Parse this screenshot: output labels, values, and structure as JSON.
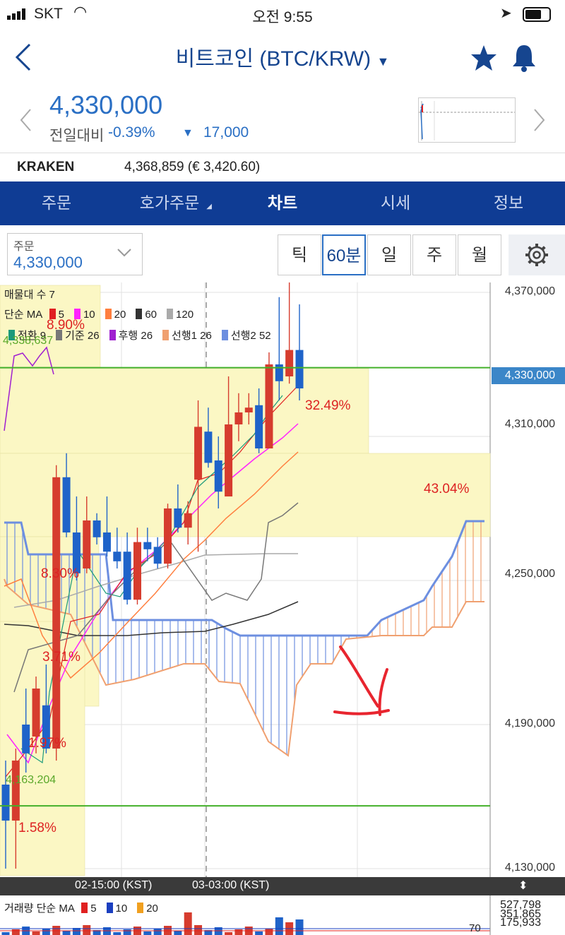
{
  "status_bar": {
    "carrier": "SKT",
    "time": "오전 9:55"
  },
  "nav": {
    "title": "비트코인 (BTC/KRW)"
  },
  "quote": {
    "price": "4,330,000",
    "change_label": "전일대비",
    "change_pct": "-0.39%",
    "change_amount": "17,000"
  },
  "exchange": {
    "name": "KRAKEN",
    "value": "4,368,859 (€ 3,420.60)"
  },
  "tabs": [
    "주문",
    "호가주문",
    "차트",
    "시세",
    "정보"
  ],
  "order_box": {
    "label": "주문",
    "value": "4,330,000"
  },
  "periods": [
    "틱",
    "60분",
    "일",
    "주",
    "월"
  ],
  "chart": {
    "volume_profile_label": "매물대 수 7",
    "ma_label": "단순 MA",
    "ma_items": [
      {
        "label": "5",
        "color": "#e02020"
      },
      {
        "label": "10",
        "color": "#ff22ff"
      },
      {
        "label": "20",
        "color": "#ff7f3f"
      },
      {
        "label": "60",
        "color": "#333333"
      },
      {
        "label": "120",
        "color": "#aaaaaa"
      }
    ],
    "ichimoku_items": [
      {
        "label": "전환 9",
        "color": "#1a9a7a"
      },
      {
        "label": "기준 26",
        "color": "#777777"
      },
      {
        "label": "후행 26",
        "color": "#a020d0"
      },
      {
        "label": "선행1 26",
        "color": "#f0a070"
      },
      {
        "label": "선행2 52",
        "color": "#6d8fe0"
      }
    ],
    "y_ticks": [
      "4,370,000",
      "4,310,000",
      "4,250,000",
      "4,190,000",
      "4,130,000"
    ],
    "current_price_tag": "4,330,000",
    "high_mark": "4,338,637",
    "low_mark": "4,163,204",
    "profile_pcts": [
      "8.90%",
      "32.49%",
      "43.04%",
      "8.30%",
      "3.71%",
      "1.97%",
      "1.58%"
    ],
    "x_ticks": [
      "02-15:00 (KST)",
      "03-03:00 (KST)"
    ],
    "volume_label": "거래량 단순 MA",
    "volume_ma_items": [
      {
        "label": "5",
        "color": "#e02020"
      },
      {
        "label": "10",
        "color": "#1b3fc0"
      },
      {
        "label": "20",
        "color": "#f0a020"
      }
    ],
    "volume_ticks": [
      "527,798",
      "351,865",
      "175,933"
    ],
    "volume_corner": "70"
  },
  "chart_data": {
    "type": "candlestick",
    "ylim": [
      4130000,
      4375000
    ],
    "candles": [
      {
        "o": 4165000,
        "h": 4175000,
        "l": 4130000,
        "c": 4150000
      },
      {
        "o": 4150000,
        "h": 4180000,
        "l": 4130000,
        "c": 4175000
      },
      {
        "o": 4190000,
        "h": 4205000,
        "l": 4170000,
        "c": 4178000
      },
      {
        "o": 4185000,
        "h": 4210000,
        "l": 4178000,
        "c": 4205000
      },
      {
        "o": 4198000,
        "h": 4215000,
        "l": 4178000,
        "c": 4180000
      },
      {
        "o": 4180000,
        "h": 4298000,
        "l": 4175000,
        "c": 4293000
      },
      {
        "o": 4293000,
        "h": 4303000,
        "l": 4268000,
        "c": 4270000
      },
      {
        "o": 4270000,
        "h": 4285000,
        "l": 4250000,
        "c": 4253000
      },
      {
        "o": 4255000,
        "h": 4285000,
        "l": 4253000,
        "c": 4275000
      },
      {
        "o": 4275000,
        "h": 4278000,
        "l": 4265000,
        "c": 4268000
      },
      {
        "o": 4270000,
        "h": 4285000,
        "l": 4260000,
        "c": 4262000
      },
      {
        "o": 4262000,
        "h": 4272000,
        "l": 4255000,
        "c": 4258000
      },
      {
        "o": 4262000,
        "h": 4270000,
        "l": 4240000,
        "c": 4242000
      },
      {
        "o": 4242000,
        "h": 4272000,
        "l": 4240000,
        "c": 4266000
      },
      {
        "o": 4266000,
        "h": 4272000,
        "l": 4258000,
        "c": 4263000
      },
      {
        "o": 4264000,
        "h": 4268000,
        "l": 4255000,
        "c": 4257000
      },
      {
        "o": 4257000,
        "h": 4282000,
        "l": 4255000,
        "c": 4280000
      },
      {
        "o": 4280000,
        "h": 4290000,
        "l": 4270000,
        "c": 4272000
      },
      {
        "o": 4272000,
        "h": 4283000,
        "l": 4265000,
        "c": 4278000
      },
      {
        "o": 4292000,
        "h": 4325000,
        "l": 4262000,
        "c": 4314000
      },
      {
        "o": 4312000,
        "h": 4322000,
        "l": 4297000,
        "c": 4299000
      },
      {
        "o": 4300000,
        "h": 4310000,
        "l": 4280000,
        "c": 4287000
      },
      {
        "o": 4285000,
        "h": 4335000,
        "l": 4285000,
        "c": 4315000
      },
      {
        "o": 4315000,
        "h": 4328000,
        "l": 4308000,
        "c": 4320000
      },
      {
        "o": 4320000,
        "h": 4328000,
        "l": 4315000,
        "c": 4322000
      },
      {
        "o": 4323000,
        "h": 4330000,
        "l": 4303000,
        "c": 4305000
      },
      {
        "o": 4305000,
        "h": 4345000,
        "l": 4305000,
        "c": 4340000
      },
      {
        "o": 4340000,
        "h": 4368000,
        "l": 4325000,
        "c": 4333000
      },
      {
        "o": 4335000,
        "h": 4375000,
        "l": 4332000,
        "c": 4346000
      },
      {
        "o": 4346000,
        "h": 4365000,
        "l": 4325000,
        "c": 4330000
      }
    ]
  }
}
